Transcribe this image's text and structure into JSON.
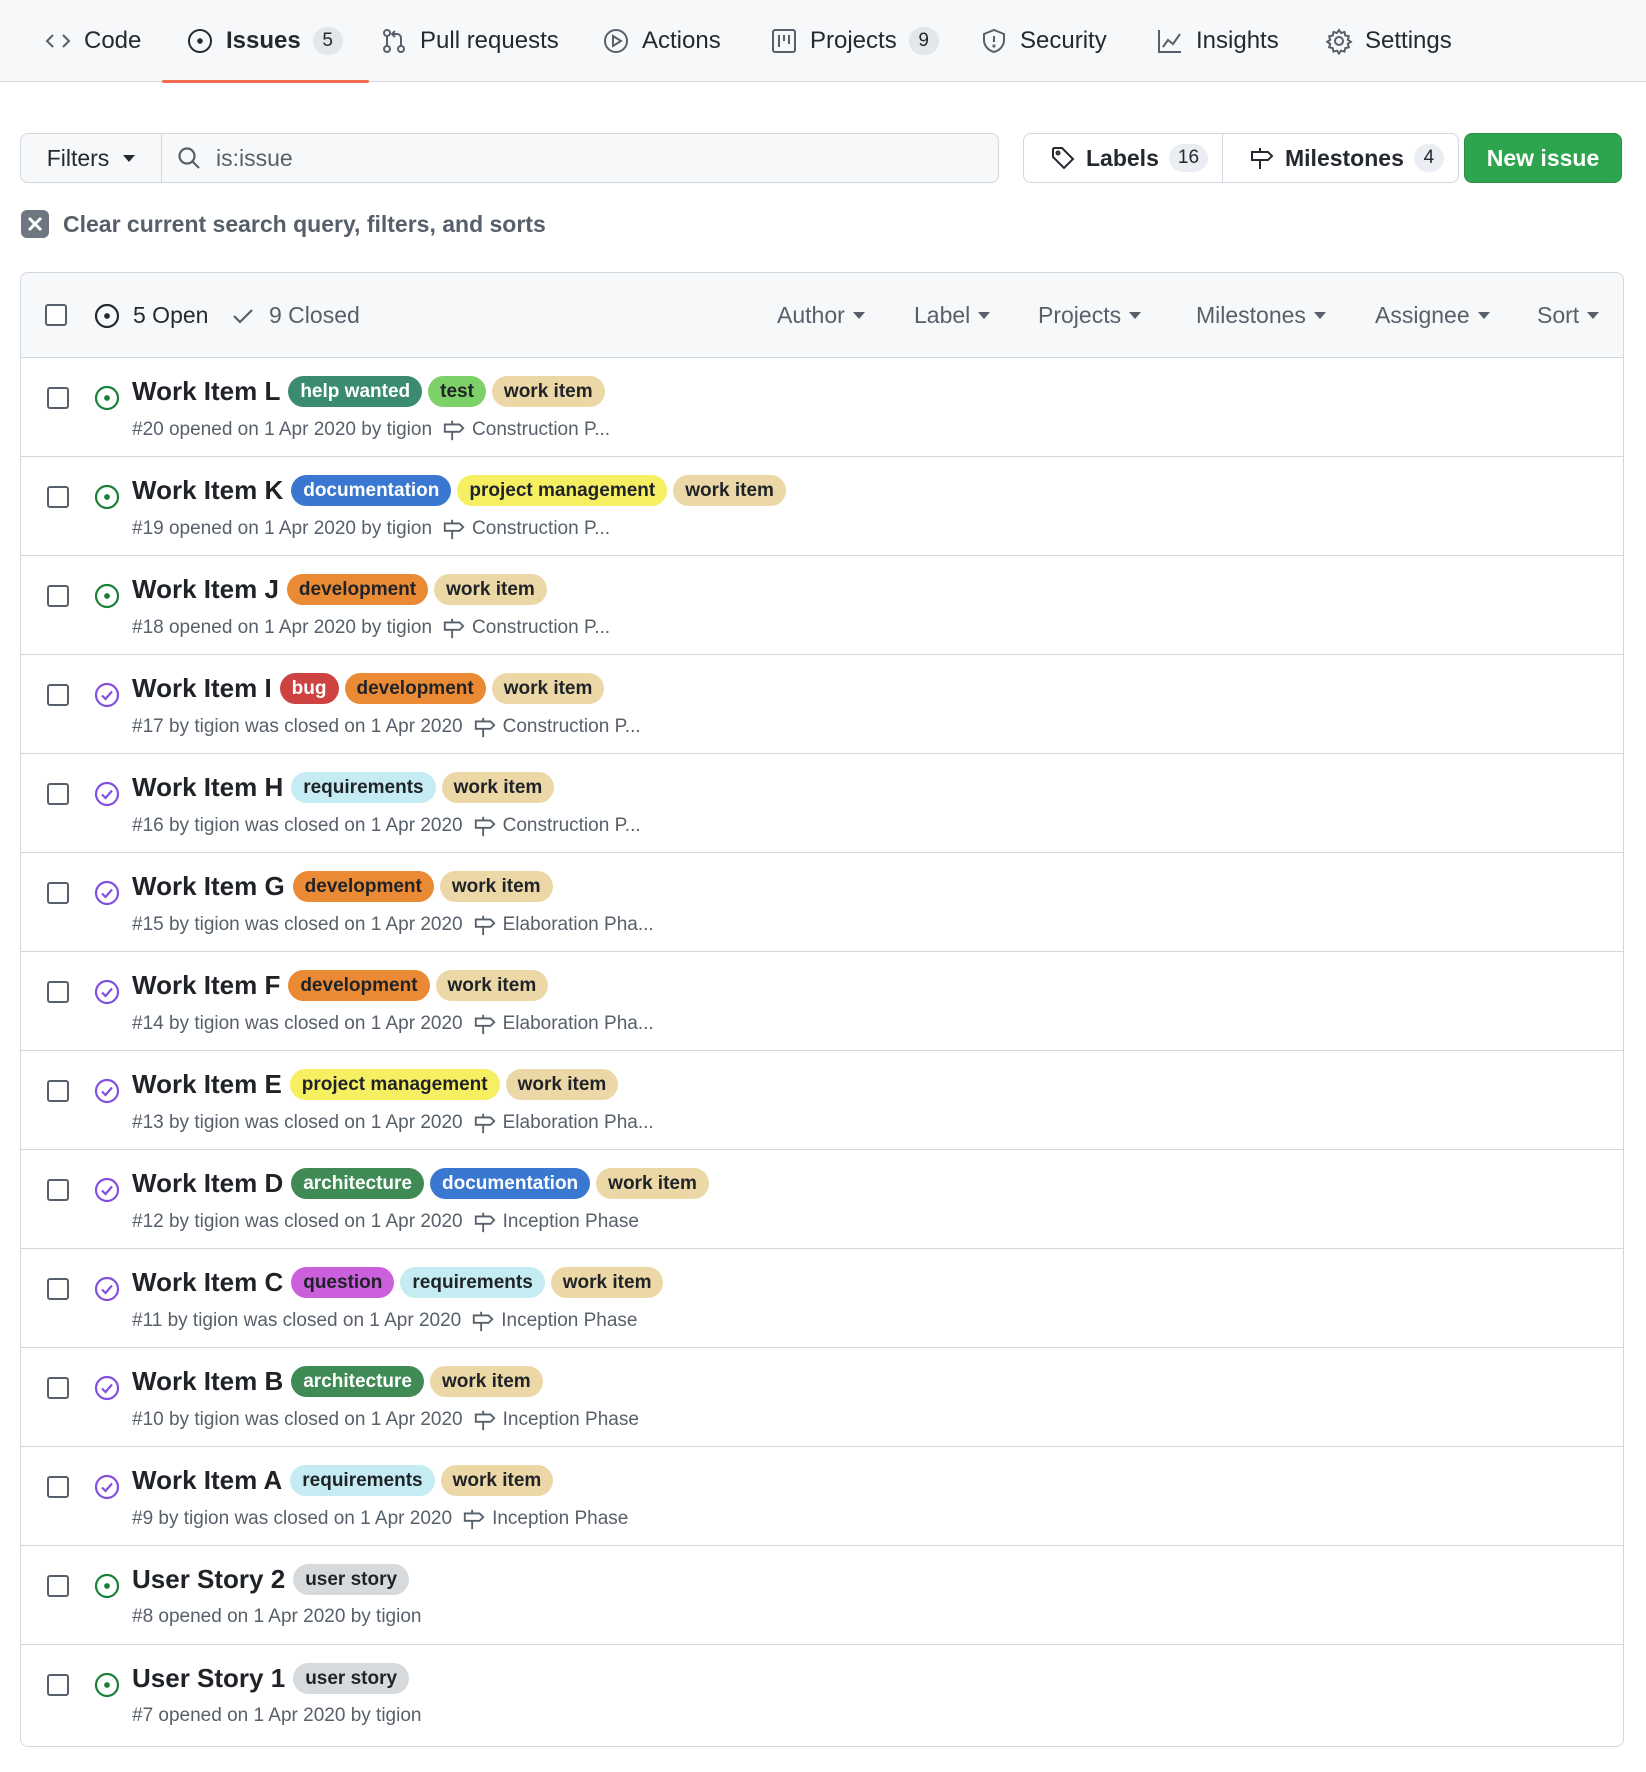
{
  "tabs": [
    {
      "label": "Code",
      "icon": "code-icon"
    },
    {
      "label": "Issues",
      "count": "5",
      "icon": "issue-opened-icon",
      "selected": true
    },
    {
      "label": "Pull requests",
      "icon": "git-pull-request-icon"
    },
    {
      "label": "Actions",
      "icon": "play-icon"
    },
    {
      "label": "Projects",
      "count": "9",
      "icon": "project-icon"
    },
    {
      "label": "Security",
      "icon": "shield-icon"
    },
    {
      "label": "Insights",
      "icon": "graph-icon"
    },
    {
      "label": "Settings",
      "icon": "gear-icon"
    }
  ],
  "search": {
    "filters_label": "Filters",
    "query": "is:issue",
    "labels_label": "Labels",
    "labels_count": "16",
    "milestones_label": "Milestones",
    "milestones_count": "4",
    "new_issue_label": "New issue"
  },
  "clear_query_text": "Clear current search query, filters, and sorts",
  "list_header": {
    "open_label": "5 Open",
    "closed_label": "9 Closed",
    "filters": [
      "Author",
      "Label",
      "Projects",
      "Milestones",
      "Assignee",
      "Sort"
    ]
  },
  "label_colors": {
    "help wanted": {
      "bg": "#3b8b6e",
      "fg": "#ffffff"
    },
    "test": {
      "bg": "#7ed068",
      "fg": "#1f2328"
    },
    "work item": {
      "bg": "#ecd7a6",
      "fg": "#1f2328"
    },
    "documentation": {
      "bg": "#3977d1",
      "fg": "#ffffff"
    },
    "project management": {
      "bg": "#f6ef62",
      "fg": "#1f2328"
    },
    "development": {
      "bg": "#ea8a34",
      "fg": "#1f2328"
    },
    "bug": {
      "bg": "#cf4242",
      "fg": "#ffffff"
    },
    "requirements": {
      "bg": "#c5ecf2",
      "fg": "#1f2328"
    },
    "architecture": {
      "bg": "#3f8a55",
      "fg": "#ffffff"
    },
    "question": {
      "bg": "#cc5fdc",
      "fg": "#1f2328"
    },
    "user story": {
      "bg": "#d7dadd",
      "fg": "#1f2328"
    }
  },
  "state_colors": {
    "open": "#1a7f37",
    "closed": "#8250df"
  },
  "issues": [
    {
      "title": "Work Item L",
      "state": "open",
      "labels": [
        "help wanted",
        "test",
        "work item"
      ],
      "meta": "#20 opened on 1 Apr 2020 by tigion",
      "milestone": "Construction P..."
    },
    {
      "title": "Work Item K",
      "state": "open",
      "labels": [
        "documentation",
        "project management",
        "work item"
      ],
      "meta": "#19 opened on 1 Apr 2020 by tigion",
      "milestone": "Construction P..."
    },
    {
      "title": "Work Item J",
      "state": "open",
      "labels": [
        "development",
        "work item"
      ],
      "meta": "#18 opened on 1 Apr 2020 by tigion",
      "milestone": "Construction P..."
    },
    {
      "title": "Work Item I",
      "state": "closed",
      "labels": [
        "bug",
        "development",
        "work item"
      ],
      "meta": "#17 by tigion was closed on 1 Apr 2020",
      "milestone": "Construction P..."
    },
    {
      "title": "Work Item H",
      "state": "closed",
      "labels": [
        "requirements",
        "work item"
      ],
      "meta": "#16 by tigion was closed on 1 Apr 2020",
      "milestone": "Construction P..."
    },
    {
      "title": "Work Item G",
      "state": "closed",
      "labels": [
        "development",
        "work item"
      ],
      "meta": "#15 by tigion was closed on 1 Apr 2020",
      "milestone": "Elaboration Pha..."
    },
    {
      "title": "Work Item F",
      "state": "closed",
      "labels": [
        "development",
        "work item"
      ],
      "meta": "#14 by tigion was closed on 1 Apr 2020",
      "milestone": "Elaboration Pha..."
    },
    {
      "title": "Work Item E",
      "state": "closed",
      "labels": [
        "project management",
        "work item"
      ],
      "meta": "#13 by tigion was closed on 1 Apr 2020",
      "milestone": "Elaboration Pha..."
    },
    {
      "title": "Work Item D",
      "state": "closed",
      "labels": [
        "architecture",
        "documentation",
        "work item"
      ],
      "meta": "#12 by tigion was closed on 1 Apr 2020",
      "milestone": "Inception Phase"
    },
    {
      "title": "Work Item C",
      "state": "closed",
      "labels": [
        "question",
        "requirements",
        "work item"
      ],
      "meta": "#11 by tigion was closed on 1 Apr 2020",
      "milestone": "Inception Phase"
    },
    {
      "title": "Work Item B",
      "state": "closed",
      "labels": [
        "architecture",
        "work item"
      ],
      "meta": "#10 by tigion was closed on 1 Apr 2020",
      "milestone": "Inception Phase"
    },
    {
      "title": "Work Item A",
      "state": "closed",
      "labels": [
        "requirements",
        "work item"
      ],
      "meta": "#9 by tigion was closed on 1 Apr 2020",
      "milestone": "Inception Phase"
    },
    {
      "title": "User Story 2",
      "state": "open",
      "labels": [
        "user story"
      ],
      "meta": "#8 opened on 1 Apr 2020 by tigion",
      "milestone": ""
    },
    {
      "title": "User Story 1",
      "state": "open",
      "labels": [
        "user story"
      ],
      "meta": "#7 opened on 1 Apr 2020 by tigion",
      "milestone": ""
    }
  ]
}
